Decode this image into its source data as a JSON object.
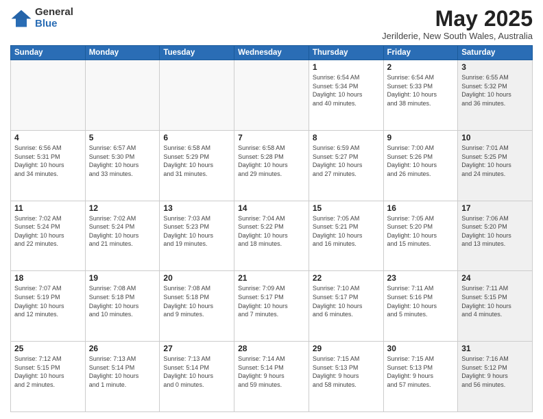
{
  "header": {
    "logo_general": "General",
    "logo_blue": "Blue",
    "month_title": "May 2025",
    "location": "Jerilderie, New South Wales, Australia"
  },
  "weekdays": [
    "Sunday",
    "Monday",
    "Tuesday",
    "Wednesday",
    "Thursday",
    "Friday",
    "Saturday"
  ],
  "weeks": [
    [
      {
        "day": "",
        "info": "",
        "empty": true
      },
      {
        "day": "",
        "info": "",
        "empty": true
      },
      {
        "day": "",
        "info": "",
        "empty": true
      },
      {
        "day": "",
        "info": "",
        "empty": true
      },
      {
        "day": "1",
        "info": "Sunrise: 6:54 AM\nSunset: 5:34 PM\nDaylight: 10 hours\nand 40 minutes."
      },
      {
        "day": "2",
        "info": "Sunrise: 6:54 AM\nSunset: 5:33 PM\nDaylight: 10 hours\nand 38 minutes."
      },
      {
        "day": "3",
        "info": "Sunrise: 6:55 AM\nSunset: 5:32 PM\nDaylight: 10 hours\nand 36 minutes.",
        "shaded": true
      }
    ],
    [
      {
        "day": "4",
        "info": "Sunrise: 6:56 AM\nSunset: 5:31 PM\nDaylight: 10 hours\nand 34 minutes."
      },
      {
        "day": "5",
        "info": "Sunrise: 6:57 AM\nSunset: 5:30 PM\nDaylight: 10 hours\nand 33 minutes."
      },
      {
        "day": "6",
        "info": "Sunrise: 6:58 AM\nSunset: 5:29 PM\nDaylight: 10 hours\nand 31 minutes."
      },
      {
        "day": "7",
        "info": "Sunrise: 6:58 AM\nSunset: 5:28 PM\nDaylight: 10 hours\nand 29 minutes."
      },
      {
        "day": "8",
        "info": "Sunrise: 6:59 AM\nSunset: 5:27 PM\nDaylight: 10 hours\nand 27 minutes."
      },
      {
        "day": "9",
        "info": "Sunrise: 7:00 AM\nSunset: 5:26 PM\nDaylight: 10 hours\nand 26 minutes."
      },
      {
        "day": "10",
        "info": "Sunrise: 7:01 AM\nSunset: 5:25 PM\nDaylight: 10 hours\nand 24 minutes.",
        "shaded": true
      }
    ],
    [
      {
        "day": "11",
        "info": "Sunrise: 7:02 AM\nSunset: 5:24 PM\nDaylight: 10 hours\nand 22 minutes."
      },
      {
        "day": "12",
        "info": "Sunrise: 7:02 AM\nSunset: 5:24 PM\nDaylight: 10 hours\nand 21 minutes."
      },
      {
        "day": "13",
        "info": "Sunrise: 7:03 AM\nSunset: 5:23 PM\nDaylight: 10 hours\nand 19 minutes."
      },
      {
        "day": "14",
        "info": "Sunrise: 7:04 AM\nSunset: 5:22 PM\nDaylight: 10 hours\nand 18 minutes."
      },
      {
        "day": "15",
        "info": "Sunrise: 7:05 AM\nSunset: 5:21 PM\nDaylight: 10 hours\nand 16 minutes."
      },
      {
        "day": "16",
        "info": "Sunrise: 7:05 AM\nSunset: 5:20 PM\nDaylight: 10 hours\nand 15 minutes."
      },
      {
        "day": "17",
        "info": "Sunrise: 7:06 AM\nSunset: 5:20 PM\nDaylight: 10 hours\nand 13 minutes.",
        "shaded": true
      }
    ],
    [
      {
        "day": "18",
        "info": "Sunrise: 7:07 AM\nSunset: 5:19 PM\nDaylight: 10 hours\nand 12 minutes."
      },
      {
        "day": "19",
        "info": "Sunrise: 7:08 AM\nSunset: 5:18 PM\nDaylight: 10 hours\nand 10 minutes."
      },
      {
        "day": "20",
        "info": "Sunrise: 7:08 AM\nSunset: 5:18 PM\nDaylight: 10 hours\nand 9 minutes."
      },
      {
        "day": "21",
        "info": "Sunrise: 7:09 AM\nSunset: 5:17 PM\nDaylight: 10 hours\nand 7 minutes."
      },
      {
        "day": "22",
        "info": "Sunrise: 7:10 AM\nSunset: 5:17 PM\nDaylight: 10 hours\nand 6 minutes."
      },
      {
        "day": "23",
        "info": "Sunrise: 7:11 AM\nSunset: 5:16 PM\nDaylight: 10 hours\nand 5 minutes."
      },
      {
        "day": "24",
        "info": "Sunrise: 7:11 AM\nSunset: 5:15 PM\nDaylight: 10 hours\nand 4 minutes.",
        "shaded": true
      }
    ],
    [
      {
        "day": "25",
        "info": "Sunrise: 7:12 AM\nSunset: 5:15 PM\nDaylight: 10 hours\nand 2 minutes."
      },
      {
        "day": "26",
        "info": "Sunrise: 7:13 AM\nSunset: 5:14 PM\nDaylight: 10 hours\nand 1 minute."
      },
      {
        "day": "27",
        "info": "Sunrise: 7:13 AM\nSunset: 5:14 PM\nDaylight: 10 hours\nand 0 minutes."
      },
      {
        "day": "28",
        "info": "Sunrise: 7:14 AM\nSunset: 5:14 PM\nDaylight: 9 hours\nand 59 minutes."
      },
      {
        "day": "29",
        "info": "Sunrise: 7:15 AM\nSunset: 5:13 PM\nDaylight: 9 hours\nand 58 minutes."
      },
      {
        "day": "30",
        "info": "Sunrise: 7:15 AM\nSunset: 5:13 PM\nDaylight: 9 hours\nand 57 minutes."
      },
      {
        "day": "31",
        "info": "Sunrise: 7:16 AM\nSunset: 5:12 PM\nDaylight: 9 hours\nand 56 minutes.",
        "shaded": true
      }
    ]
  ]
}
